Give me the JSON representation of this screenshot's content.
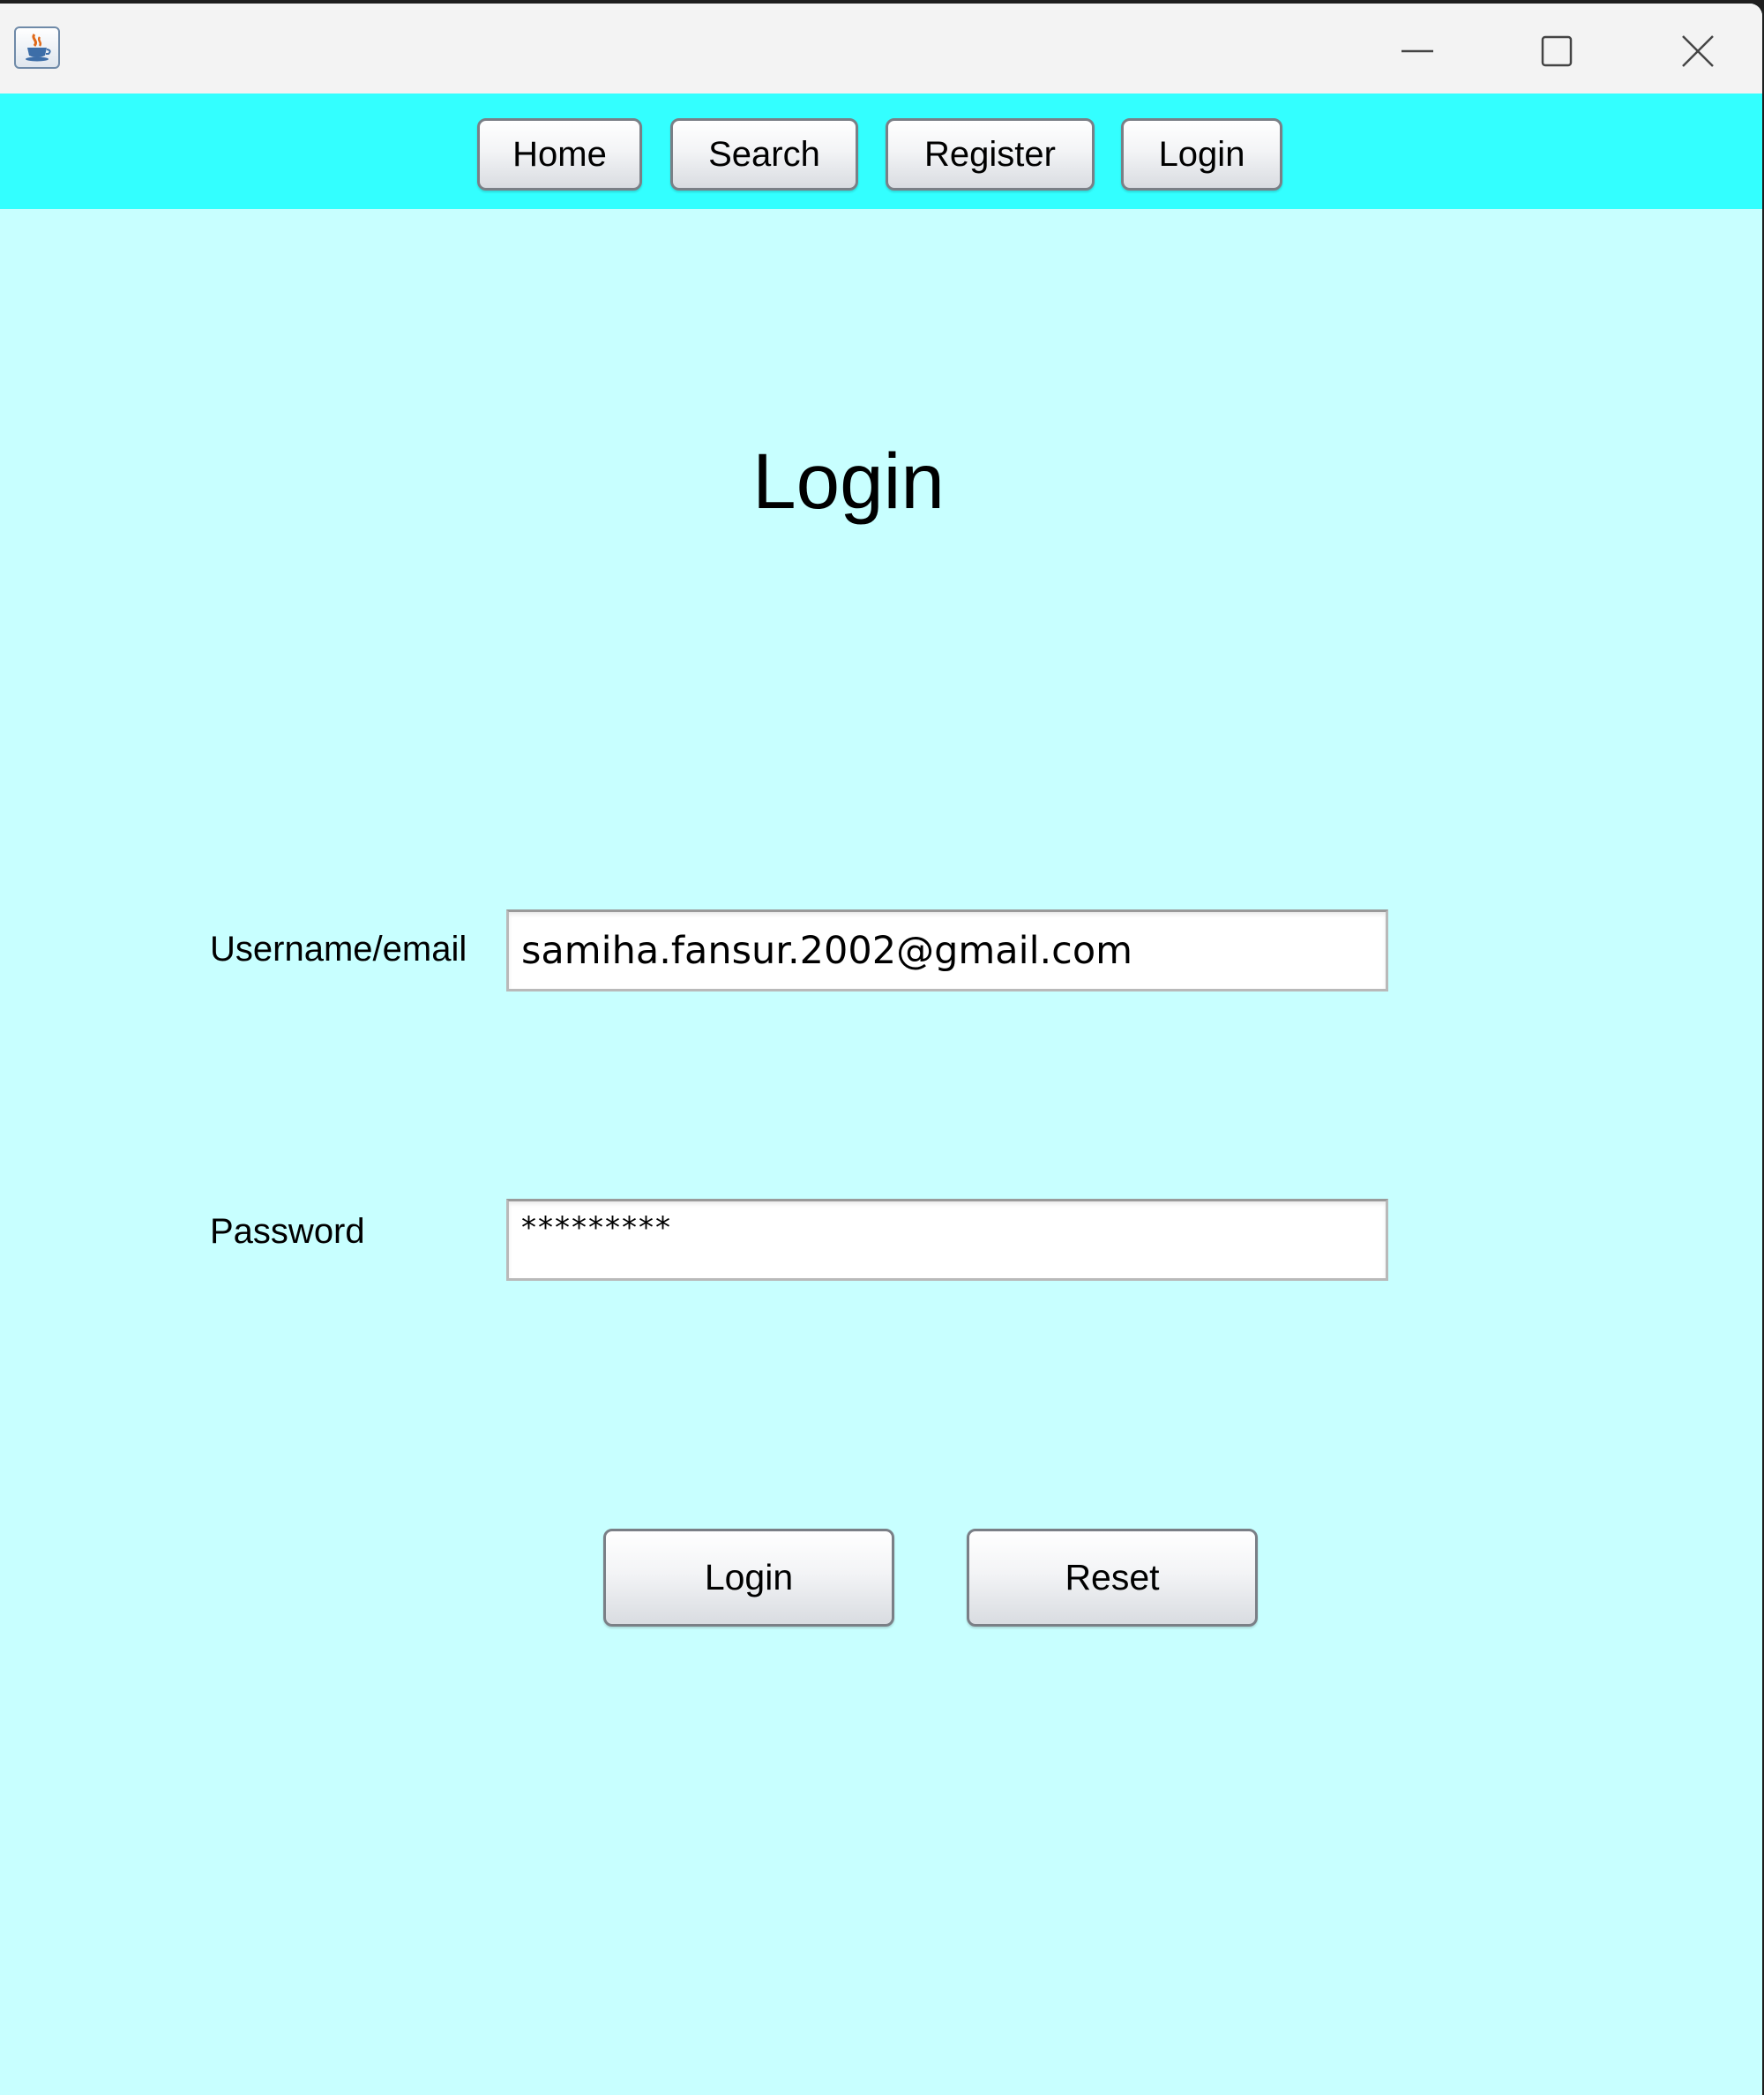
{
  "nav": {
    "home": "Home",
    "search": "Search",
    "register": "Register",
    "login": "Login"
  },
  "page": {
    "title": "Login"
  },
  "form": {
    "username_label": "Username/email",
    "username_value": "samiha.fansur.2002@gmail.com",
    "password_label": "Password",
    "password_value": "*********",
    "login_label": "Login",
    "reset_label": "Reset"
  },
  "colors": {
    "navbar": "#33ffff",
    "background": "#c8ffff",
    "titlebar": "#f3f3f3"
  },
  "icons": {
    "app": "java-cup-icon",
    "minimize": "minimize-icon",
    "maximize": "maximize-icon",
    "close": "close-icon"
  }
}
